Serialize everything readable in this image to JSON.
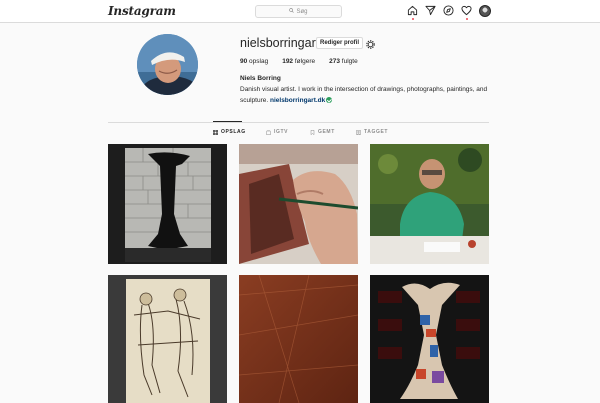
{
  "nav": {
    "logo": "Instagram",
    "search_placeholder": "Søg",
    "icons": [
      "home-icon",
      "direct-icon",
      "explore-icon",
      "activity-icon",
      "profile-avatar"
    ]
  },
  "profile": {
    "username": "niels_borring_art",
    "display_username": "nielsborringart",
    "edit_button": "Rediger profil",
    "stats": {
      "posts_count": "90",
      "posts_label": "opslag",
      "followers_count": "192",
      "followers_label": "følgere",
      "following_count": "273",
      "following_label": "fulgte"
    },
    "full_name": "Niels Borring",
    "bio": "Danish visual artist. I work in the intersection of drawings, photographs, paintings, and sculpture.",
    "link": "nielsborringart.dk"
  },
  "tabs": [
    {
      "label": "OPSLAG",
      "icon": "grid-icon",
      "active": true
    },
    {
      "label": "IGTV",
      "icon": "igtv-icon",
      "active": false
    },
    {
      "label": "GEMT",
      "icon": "bookmark-icon",
      "active": false
    },
    {
      "label": "TAGGET",
      "icon": "tag-icon",
      "active": false
    }
  ],
  "posts": [
    "artwork-brick-wall-figure",
    "drawing-hand-with-pencil",
    "artist-portrait-at-desk",
    "engraving-figures",
    "red-painting-texture",
    "sculpture-collage-figure"
  ],
  "colors": {
    "background": "#fafafa",
    "border": "#dbdbdb",
    "text": "#262626",
    "muted": "#8e8e8e",
    "link": "#00376b",
    "notification": "#ed4956"
  }
}
